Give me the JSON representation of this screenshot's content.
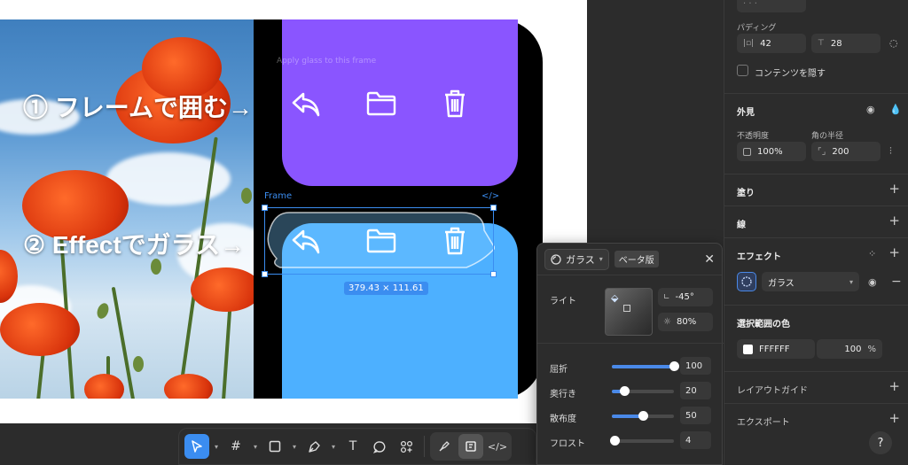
{
  "canvas": {
    "caption1": "① フレームで囲む→",
    "caption2": "② Effectでガラス→",
    "hint_text": "Apply glass to this frame",
    "frame_label": "Frame",
    "code_label": "</>",
    "dimensions": "379.43 × 111.61"
  },
  "toolbar": {
    "tools": [
      "move-tool",
      "frame-tool",
      "shape-tool",
      "pen-tool",
      "text-tool",
      "comment-tool",
      "actions-tool"
    ],
    "text_glyph": "T"
  },
  "glass_popover": {
    "effect_name": "ガラス",
    "beta_badge": "ベータ版",
    "close": "✕",
    "light_label": "ライト",
    "angle_value": "-45°",
    "intensity_value": "80%",
    "refraction_label": "屈折",
    "refraction_value": "100",
    "refraction_level": 1.0,
    "depth_label": "奥行き",
    "depth_value": "20",
    "depth_level": 0.2,
    "dispersion_label": "散布度",
    "dispersion_value": "50",
    "dispersion_level": 0.5,
    "frost_label": "フロスト",
    "frost_value": "4",
    "frost_level": 0.04
  },
  "panel": {
    "padding_label": "パディング",
    "padding_h": "42",
    "padding_v": "28",
    "clip_content_label": "コンテンツを隠す",
    "appearance_title": "外見",
    "opacity_label": "不透明度",
    "opacity_value": "100%",
    "radius_label": "角の半径",
    "radius_value": "200",
    "fill_title": "塗り",
    "stroke_title": "線",
    "effects_title": "エフェクト",
    "effect_select": "ガラス",
    "selection_colors_title": "選択範囲の色",
    "color_hex": "FFFFFF",
    "color_opacity": "100",
    "percent": "%",
    "layout_guide_title": "レイアウトガイド",
    "export_title": "エクスポート",
    "help": "?"
  },
  "colors": {
    "accent": "#3b8df0",
    "purple_card": "#8a55ff",
    "blue_card": "#4db0ff"
  }
}
